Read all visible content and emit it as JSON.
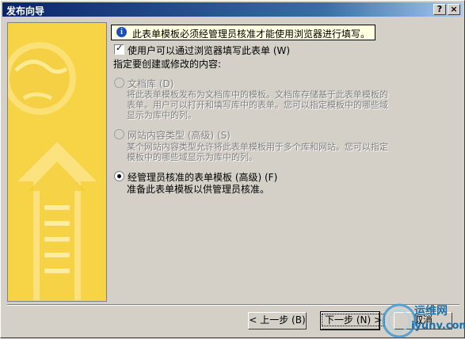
{
  "window": {
    "title": "发布向导",
    "help_glyph": "?",
    "close_glyph": "×"
  },
  "info": {
    "icon": "info-icon",
    "icon_glyph": "i",
    "text": "此表单模板必须经管理员核准才能使用浏览器进行填写。"
  },
  "browser_checkbox": {
    "checked": true,
    "mark": "✓",
    "label": "使用户可以通过浏览器填写此表单 (W)"
  },
  "prompt": "指定要创建或修改的内容:",
  "options": [
    {
      "label": "文档库 (D)",
      "description": "将此表单模板发布为文档库中的模板。文档库存储基于此表单模板的表单。用户可以打开和填写库中的表单。您可以指定模板中的哪些域显示为库中的列。",
      "enabled": false,
      "selected": false
    },
    {
      "label": "网站内容类型 (高级) (S)",
      "description": "某个网站内容类型允许将此表单模板用于多个库和网站。您可以指定模板中的哪些域显示为库中的列。",
      "enabled": false,
      "selected": false
    },
    {
      "label": "经管理员核准的表单模板 (高级) (F)",
      "description": "准备此表单模板以供管理员核准。",
      "enabled": true,
      "selected": true
    }
  ],
  "buttons": {
    "back": "< 上一步 (B)",
    "next": "下一步 (N) >",
    "cancel": "取消"
  },
  "watermark": {
    "line1": "运维网",
    "line2": "iyunv.com"
  },
  "colors": {
    "title_bar": "#0a246a",
    "panel": "#f6d23a",
    "info_background": "#ffffe1"
  }
}
